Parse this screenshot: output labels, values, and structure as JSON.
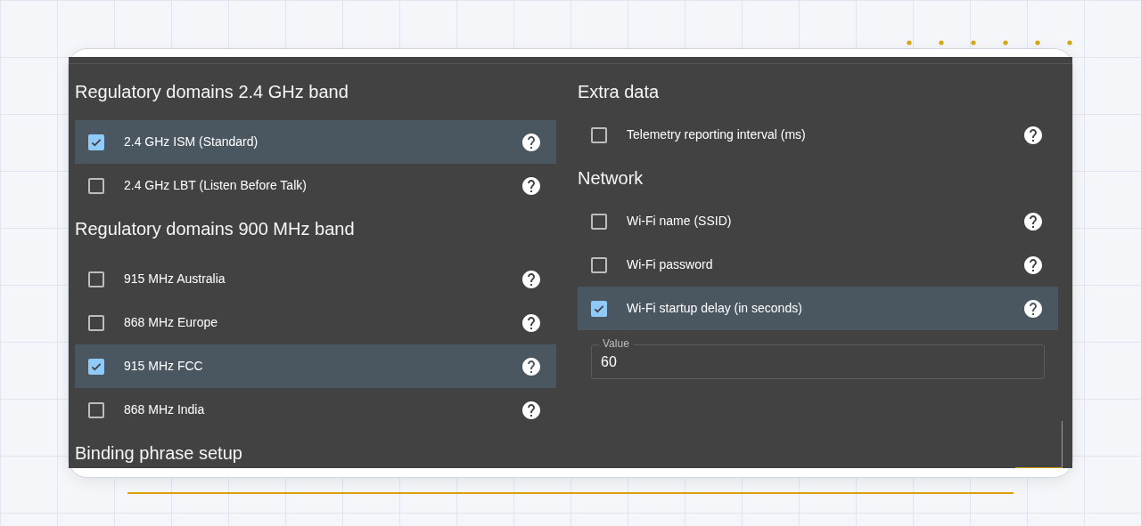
{
  "columns": [
    {
      "sections": [
        {
          "title": "Regulatory domains 2.4 GHz band",
          "items": [
            {
              "label": "2.4 GHz ISM (Standard)",
              "checked": true
            },
            {
              "label": "2.4 GHz LBT (Listen Before Talk)",
              "checked": false
            }
          ]
        },
        {
          "title": "Regulatory domains 900 MHz band",
          "items": [
            {
              "label": "915 MHz Australia",
              "checked": false
            },
            {
              "label": "868 MHz Europe",
              "checked": false
            },
            {
              "label": "915 MHz FCC",
              "checked": true
            },
            {
              "label": "868 MHz India",
              "checked": false
            }
          ]
        },
        {
          "title": "Binding phrase setup"
        }
      ]
    },
    {
      "sections": [
        {
          "title": "Extra data",
          "items": [
            {
              "label": "Telemetry reporting interval (ms)",
              "checked": false
            }
          ]
        },
        {
          "title": "Network",
          "items": [
            {
              "label": "Wi-Fi name (SSID)",
              "checked": false
            },
            {
              "label": "Wi-Fi password",
              "checked": false
            },
            {
              "label": "Wi-Fi startup delay (in seconds)",
              "checked": true
            }
          ],
          "field": {
            "label": "Value",
            "value": "60"
          }
        }
      ]
    }
  ]
}
